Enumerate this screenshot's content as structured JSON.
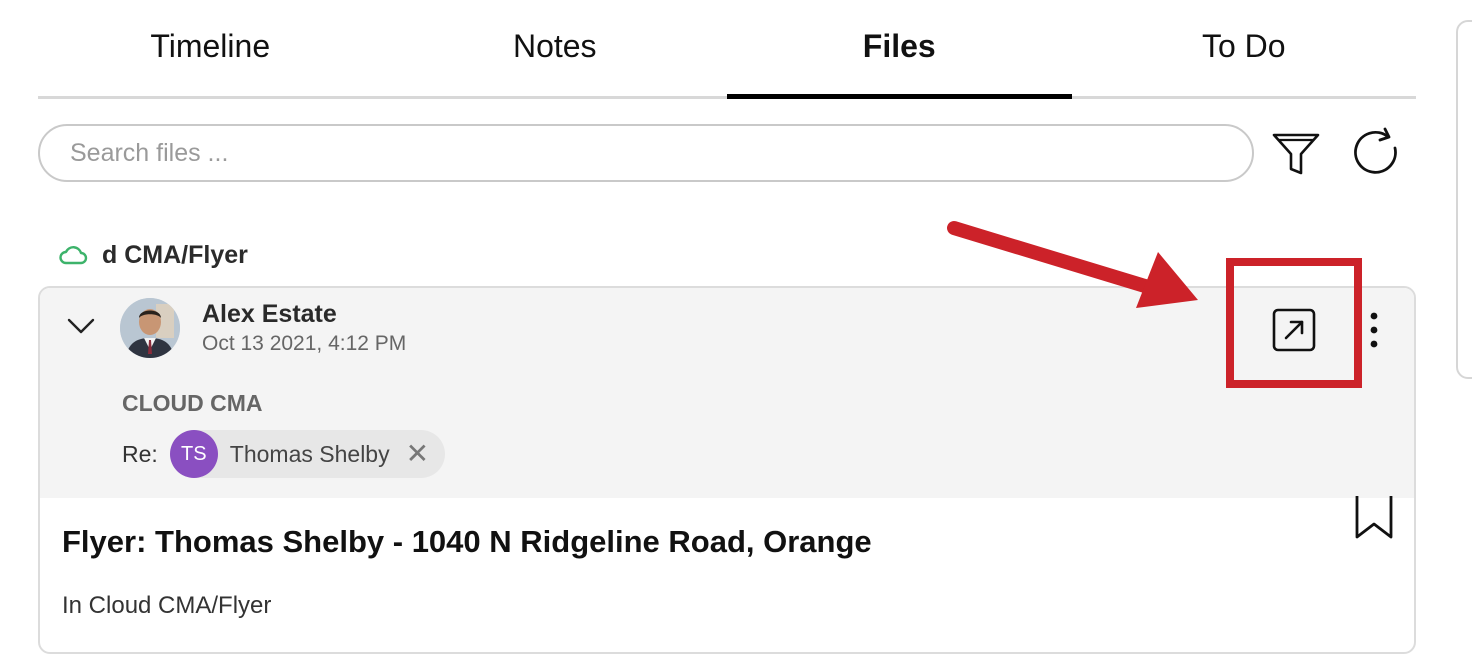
{
  "tabs": [
    {
      "label": "Timeline"
    },
    {
      "label": "Notes"
    },
    {
      "label": "Files"
    },
    {
      "label": "To Do"
    }
  ],
  "active_tab": "Files",
  "search": {
    "placeholder": "Search files ..."
  },
  "toolbar": {
    "filter_icon": "filter-icon",
    "refresh_icon": "refresh-icon"
  },
  "folder": {
    "label": "d CMA/Flyer",
    "icon": "cloud-icon",
    "icon_color": "#3db36b"
  },
  "file_card": {
    "author": "Alex Estate",
    "date": "Oct 13 2021, 4:12 PM",
    "source": "CLOUD CMA",
    "re_label": "Re:",
    "contact": {
      "initials": "TS",
      "name": "Thomas Shelby",
      "color": "#8a4fc1",
      "remove_symbol": "✕"
    },
    "title": "Flyer: Thomas Shelby - 1040 N Ridgeline Road, Orange",
    "location": "In Cloud CMA/Flyer"
  },
  "annotation": {
    "color": "#cc2229"
  }
}
